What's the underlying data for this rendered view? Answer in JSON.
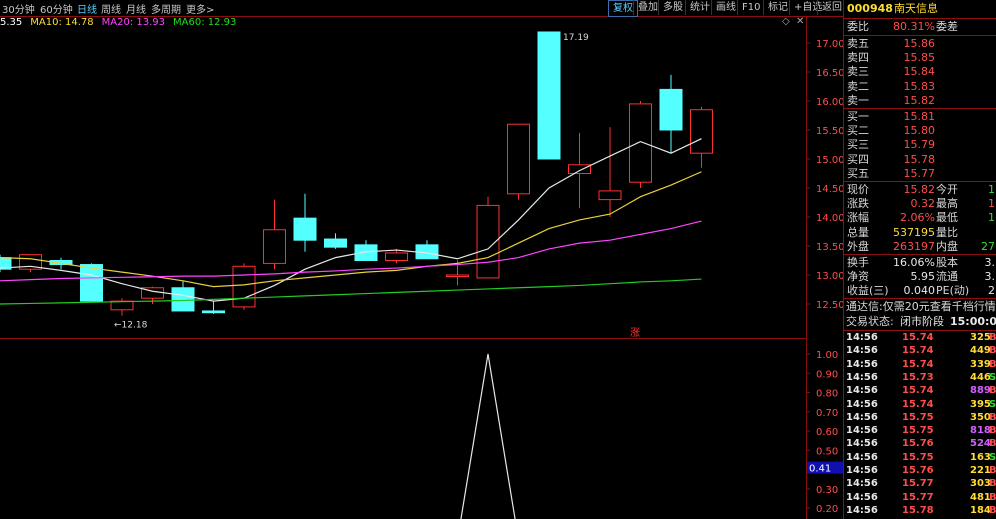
{
  "toolbar": {
    "periods": [
      "30分钟",
      "60分钟",
      "日线",
      "周线",
      "月线",
      "多周期",
      "更多>"
    ],
    "active_period": "日线",
    "buttons": [
      "复权",
      "叠加",
      "多股",
      "统计",
      "画线",
      "F10",
      "标记",
      "+自选",
      "返回"
    ],
    "active_button": "复权",
    "window_controls": [
      "◇",
      "✕"
    ]
  },
  "ma_legend": [
    {
      "label": "5.35",
      "color": "#ffffff"
    },
    {
      "label": "MA10: 14.78",
      "color": "#ffdd33"
    },
    {
      "label": "MA20: 13.93",
      "color": "#ff44ff"
    },
    {
      "label": "MA60: 12.93",
      "color": "#22dd22"
    }
  ],
  "main_chart": {
    "price_axis": [
      "17.00",
      "16.50",
      "16.00",
      "15.50",
      "15.00",
      "14.50",
      "14.00",
      "13.50",
      "13.00",
      "12.50"
    ],
    "price_range": [
      12.5,
      17.0
    ],
    "high_label": "17.19",
    "low_label": "12.18",
    "rise_marker": "涨",
    "candles": [
      {
        "o": 13.3,
        "h": 13.35,
        "l": 13.05,
        "c": 13.1
      },
      {
        "o": 13.1,
        "h": 13.35,
        "l": 13.05,
        "c": 13.35
      },
      {
        "o": 13.25,
        "h": 13.3,
        "l": 13.1,
        "c": 13.18
      },
      {
        "o": 13.18,
        "h": 13.2,
        "l": 12.55,
        "c": 12.55
      },
      {
        "o": 12.4,
        "h": 12.6,
        "l": 12.3,
        "c": 12.55
      },
      {
        "o": 12.6,
        "h": 12.8,
        "l": 12.5,
        "c": 12.78
      },
      {
        "o": 12.78,
        "h": 12.9,
        "l": 12.38,
        "c": 12.38
      },
      {
        "o": 12.38,
        "h": 12.55,
        "l": 12.33,
        "c": 12.35
      },
      {
        "o": 12.45,
        "h": 13.2,
        "l": 12.4,
        "c": 13.15
      },
      {
        "o": 13.2,
        "h": 14.3,
        "l": 13.1,
        "c": 13.78
      },
      {
        "o": 13.98,
        "h": 14.4,
        "l": 13.4,
        "c": 13.6
      },
      {
        "o": 13.62,
        "h": 13.72,
        "l": 13.45,
        "c": 13.48
      },
      {
        "o": 13.52,
        "h": 13.6,
        "l": 13.25,
        "c": 13.25
      },
      {
        "o": 13.25,
        "h": 13.45,
        "l": 13.2,
        "c": 13.38
      },
      {
        "o": 13.52,
        "h": 13.6,
        "l": 13.28,
        "c": 13.28
      },
      {
        "o": 13.0,
        "h": 13.25,
        "l": 12.82,
        "c": 13.0
      },
      {
        "o": 12.95,
        "h": 14.35,
        "l": 12.95,
        "c": 14.2
      },
      {
        "o": 14.4,
        "h": 15.6,
        "l": 14.3,
        "c": 15.6
      },
      {
        "o": 17.19,
        "h": 17.19,
        "l": 15.0,
        "c": 15.0
      },
      {
        "o": 14.75,
        "h": 15.45,
        "l": 14.15,
        "c": 14.9
      },
      {
        "o": 14.3,
        "h": 15.55,
        "l": 14.0,
        "c": 14.45
      },
      {
        "o": 14.6,
        "h": 16.0,
        "l": 14.5,
        "c": 15.95
      },
      {
        "o": 16.2,
        "h": 16.45,
        "l": 15.1,
        "c": 15.5
      },
      {
        "o": 15.1,
        "h": 15.9,
        "l": 14.85,
        "c": 15.85
      }
    ],
    "ma5": [
      13.12,
      13.15,
      13.08,
      13.0,
      12.85,
      12.72,
      12.65,
      12.55,
      12.6,
      12.82,
      13.1,
      13.3,
      13.4,
      13.43,
      13.38,
      13.28,
      13.45,
      13.95,
      14.5,
      14.8,
      15.05,
      15.3,
      15.1,
      15.35
    ],
    "ma10": [
      13.3,
      13.28,
      13.2,
      13.12,
      13.05,
      12.98,
      12.9,
      12.8,
      12.83,
      12.9,
      12.95,
      13.0,
      13.05,
      13.08,
      13.15,
      13.2,
      13.3,
      13.55,
      13.8,
      13.95,
      14.05,
      14.35,
      14.55,
      14.78
    ],
    "ma20": [
      12.9,
      12.92,
      12.94,
      12.95,
      12.96,
      12.97,
      12.98,
      12.98,
      13.0,
      13.02,
      13.05,
      13.07,
      13.1,
      13.12,
      13.15,
      13.18,
      13.22,
      13.3,
      13.45,
      13.55,
      13.6,
      13.7,
      13.8,
      13.93
    ],
    "ma60": [
      12.5,
      12.51,
      12.52,
      12.53,
      12.54,
      12.55,
      12.56,
      12.58,
      12.6,
      12.62,
      12.64,
      12.66,
      12.68,
      12.7,
      12.72,
      12.74,
      12.76,
      12.78,
      12.8,
      12.82,
      12.85,
      12.88,
      12.9,
      12.93
    ]
  },
  "sub_chart": {
    "axis": [
      "1.00",
      "0.90",
      "0.80",
      "0.70",
      "0.60",
      "0.50",
      "0.40",
      "0.30",
      "0.20"
    ],
    "range": [
      0.18,
      1.0
    ],
    "current_label": "0.41",
    "values": [
      0,
      0,
      0,
      0,
      0,
      0,
      0,
      0,
      0,
      0,
      0,
      0,
      0,
      0,
      0,
      0,
      1,
      0,
      0,
      0,
      0,
      0,
      0,
      0
    ]
  },
  "quote_panel": {
    "code": "000948",
    "name": "南天信息",
    "weibi": {
      "label": "委比",
      "value": "80.31%",
      "label2": "委差",
      "value2": ""
    },
    "asks": [
      {
        "label": "卖五",
        "price": "15.86",
        "vol": ""
      },
      {
        "label": "卖四",
        "price": "15.85",
        "vol": ""
      },
      {
        "label": "卖三",
        "price": "15.84",
        "vol": ""
      },
      {
        "label": "卖二",
        "price": "15.83",
        "vol": ""
      },
      {
        "label": "卖一",
        "price": "15.82",
        "vol": ""
      }
    ],
    "bids": [
      {
        "label": "买一",
        "price": "15.81",
        "vol": ""
      },
      {
        "label": "买二",
        "price": "15.80",
        "vol": ""
      },
      {
        "label": "买三",
        "price": "15.79",
        "vol": ""
      },
      {
        "label": "买四",
        "price": "15.78",
        "vol": ""
      },
      {
        "label": "买五",
        "price": "15.77",
        "vol": ""
      }
    ],
    "stats1": [
      {
        "l1": "现价",
        "v1": "15.82",
        "c1": "red",
        "l2": "今开",
        "v2": "1",
        "c2": "green"
      },
      {
        "l1": "涨跌",
        "v1": "0.32",
        "c1": "red",
        "l2": "最高",
        "v2": "1",
        "c2": "red"
      },
      {
        "l1": "涨幅",
        "v1": "2.06%",
        "c1": "red",
        "l2": "最低",
        "v2": "1",
        "c2": "green"
      },
      {
        "l1": "总量",
        "v1": "537195",
        "c1": "yellow",
        "l2": "量比",
        "v2": "",
        "c2": "white"
      },
      {
        "l1": "外盘",
        "v1": "263197",
        "c1": "red",
        "l2": "内盘",
        "v2": "27",
        "c2": "green"
      }
    ],
    "stats2": [
      {
        "l1": "换手",
        "v1": "16.06%",
        "c1": "white",
        "l2": "股本",
        "v2": "3.",
        "c2": "white"
      },
      {
        "l1": "净资",
        "v1": "5.95",
        "c1": "white",
        "l2": "流通",
        "v2": "3.",
        "c2": "white"
      },
      {
        "l1": "收益(三)",
        "v1": "0.040",
        "c1": "white",
        "l2": "PE(动)",
        "v2": "2",
        "c2": "white"
      }
    ],
    "notice": "通达信:仅需20元查看千档行情",
    "trade_status_label": "交易状态:",
    "trade_status": "闭市阶段",
    "trade_time": "15:00:00",
    "ticks": [
      {
        "t": "14:56",
        "p": "15.74",
        "q": "325",
        "d": "B"
      },
      {
        "t": "14:56",
        "p": "15.74",
        "q": "449",
        "d": "B"
      },
      {
        "t": "14:56",
        "p": "15.74",
        "q": "339",
        "d": "B"
      },
      {
        "t": "14:56",
        "p": "15.73",
        "q": "446",
        "d": "S"
      },
      {
        "t": "14:56",
        "p": "15.74",
        "q": "889",
        "d": "B"
      },
      {
        "t": "14:56",
        "p": "15.74",
        "q": "395",
        "d": "S"
      },
      {
        "t": "14:56",
        "p": "15.75",
        "q": "350",
        "d": "B"
      },
      {
        "t": "14:56",
        "p": "15.75",
        "q": "818",
        "d": "B"
      },
      {
        "t": "14:56",
        "p": "15.76",
        "q": "524",
        "d": "B"
      },
      {
        "t": "14:56",
        "p": "15.75",
        "q": "163",
        "d": "S"
      },
      {
        "t": "14:56",
        "p": "15.76",
        "q": "221",
        "d": "B"
      },
      {
        "t": "14:56",
        "p": "15.77",
        "q": "303",
        "d": "B"
      },
      {
        "t": "14:56",
        "p": "15.77",
        "q": "481",
        "d": "B"
      },
      {
        "t": "14:56",
        "p": "15.78",
        "q": "184",
        "d": "B"
      }
    ],
    "colors": {
      "up": "#ff4d4d",
      "down": "#2ee02e",
      "vol": "#ffdd33",
      "purple": "#d060ff"
    }
  }
}
